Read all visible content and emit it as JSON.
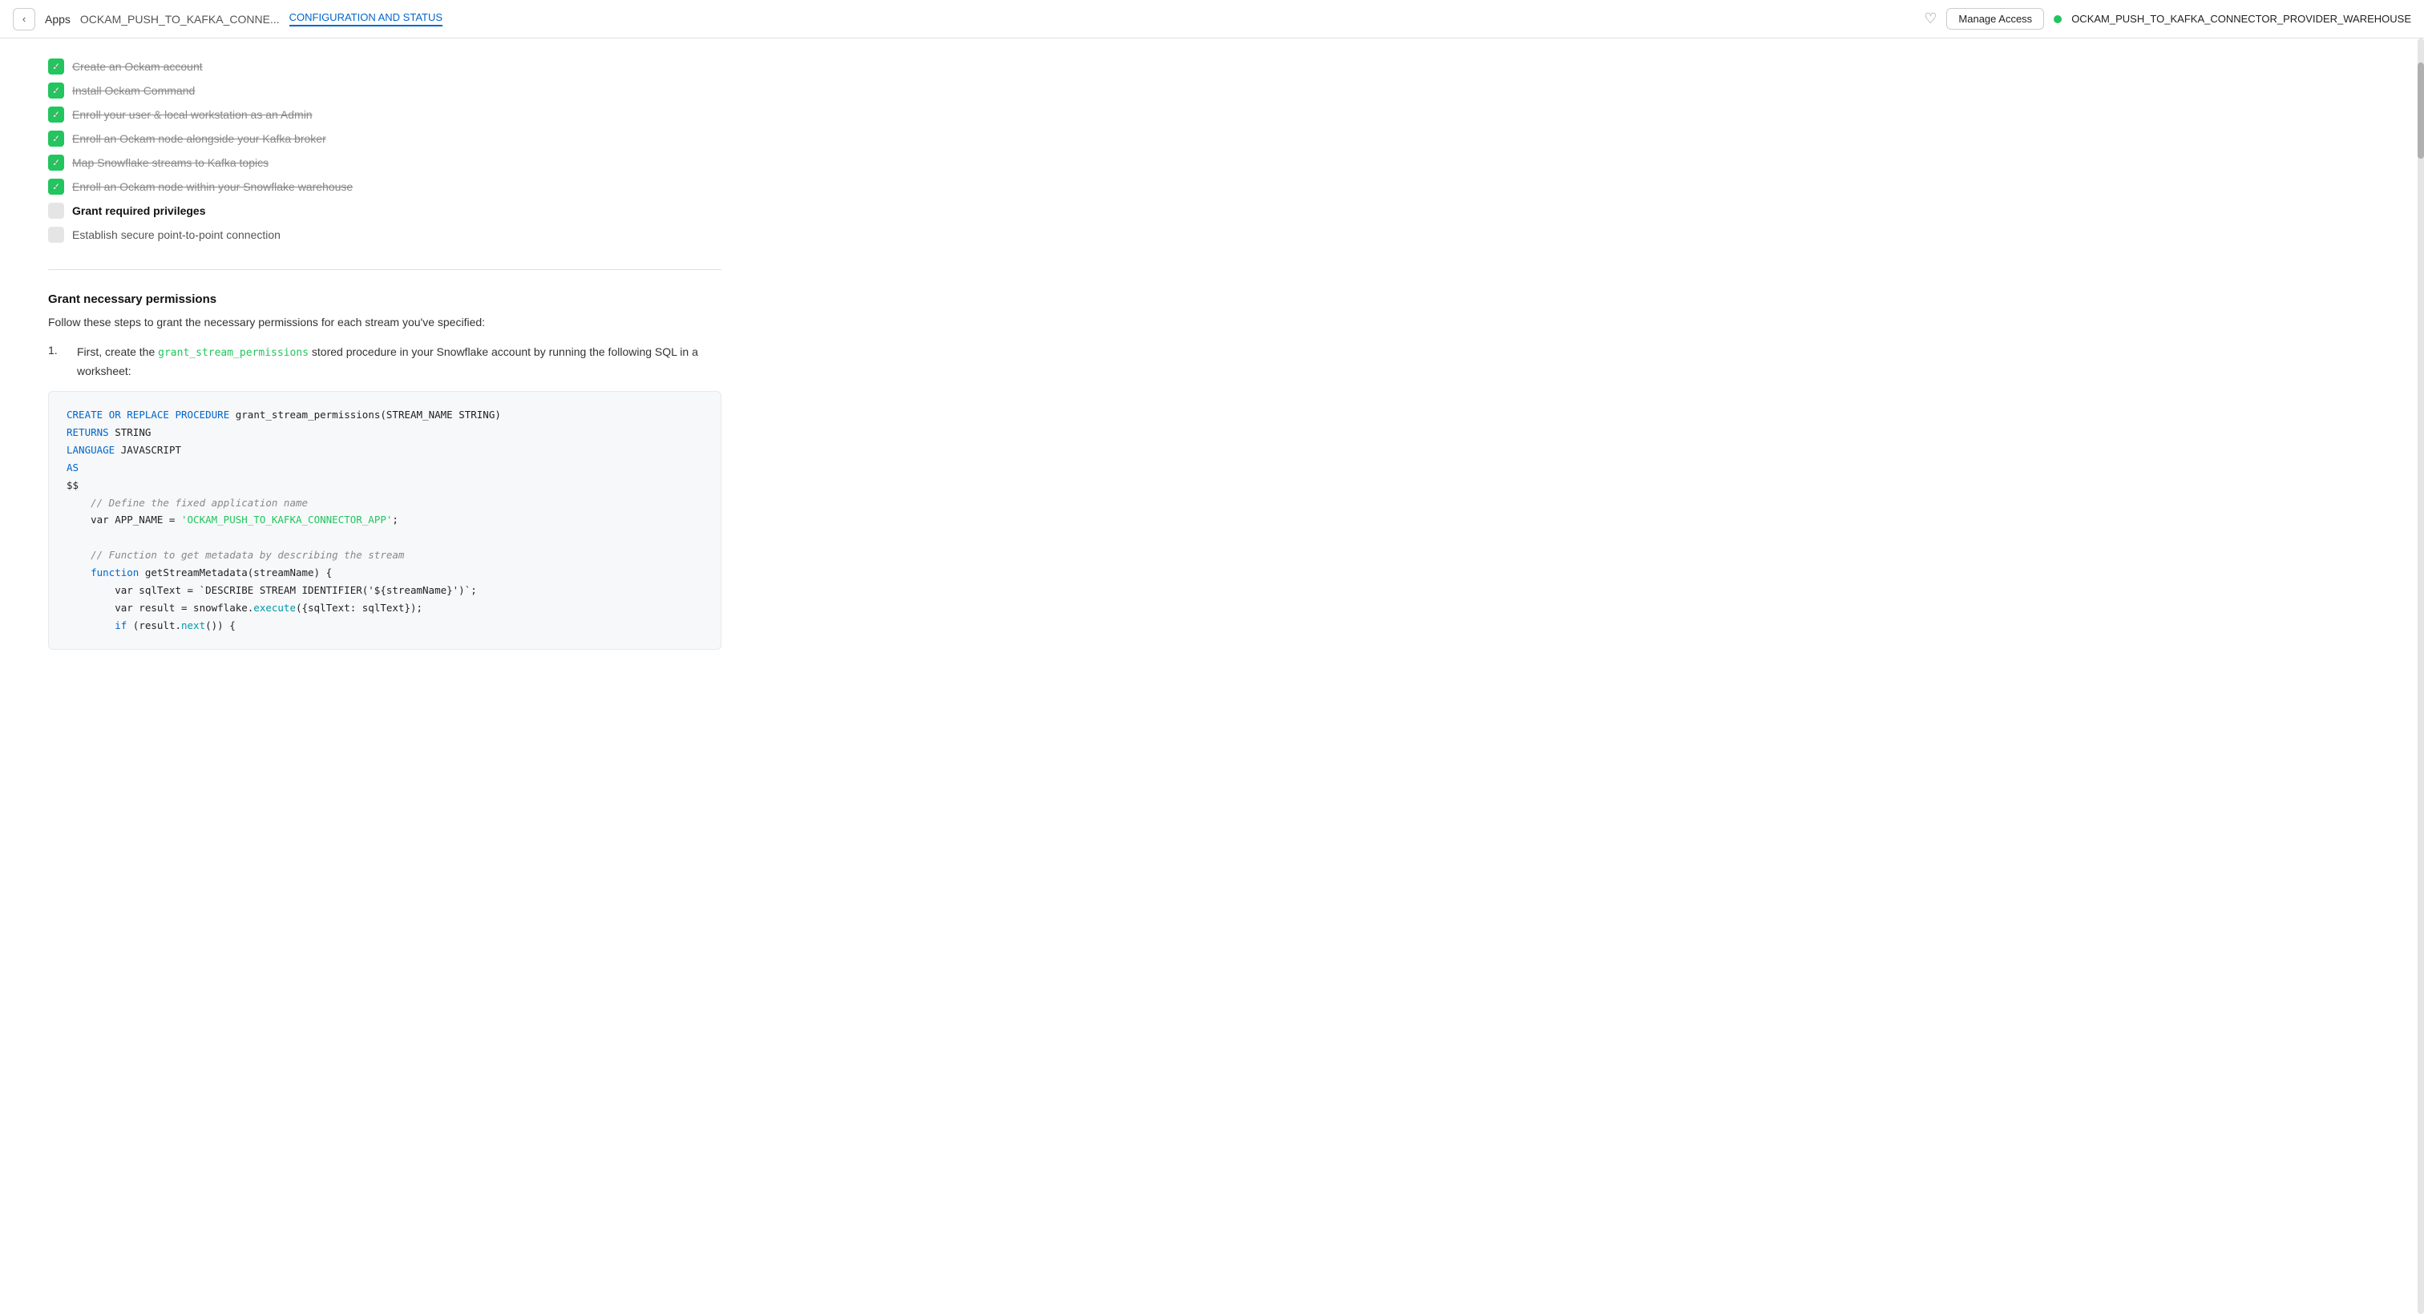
{
  "navbar": {
    "back_label": "‹",
    "apps_label": "Apps",
    "connector_name": "OCKAM_PUSH_TO_KAFKA_CONNE...",
    "tab_label": "CONFIGURATION AND STATUS",
    "manage_access_label": "Manage Access",
    "warehouse_name": "OCKAM_PUSH_TO_KAFKA_CONNECTOR_PROVIDER_WAREHOUSE"
  },
  "checklist": {
    "items": [
      {
        "id": 1,
        "label": "Create an Ockam account",
        "status": "done"
      },
      {
        "id": 2,
        "label": "Install Ockam Command",
        "status": "done"
      },
      {
        "id": 3,
        "label": "Enroll your user & local workstation as an Admin",
        "status": "done"
      },
      {
        "id": 4,
        "label": "Enroll an Ockam node alongside your Kafka broker",
        "status": "done"
      },
      {
        "id": 5,
        "label": "Map Snowflake streams to Kafka topics",
        "status": "done"
      },
      {
        "id": 6,
        "label": "Enroll an Ockam node within your Snowflake warehouse",
        "status": "done"
      },
      {
        "id": 7,
        "label": "Grant required privileges",
        "status": "active"
      },
      {
        "id": 8,
        "label": "Establish secure point-to-point connection",
        "status": "pending"
      }
    ]
  },
  "section": {
    "heading": "Grant necessary permissions",
    "description": "Follow these steps to grant the necessary permissions for each stream you've specified:",
    "step1_text_before": "First, create the ",
    "step1_code": "grant_stream_permissions",
    "step1_text_after": " stored procedure in your Snowflake account by running the following SQL in a worksheet:"
  },
  "code": {
    "line1_kw1": "CREATE",
    "line1_kw2": "OR",
    "line1_kw3": "REPLACE",
    "line1_kw4": "PROCEDURE",
    "line1_rest": " grant_stream_permissions(STREAM_NAME STRING)",
    "line2_kw": "RETURNS",
    "line2_rest": " STRING",
    "line3_kw": "LANGUAGE",
    "line3_rest": " JAVASCRIPT",
    "line4_kw": "AS",
    "line5": "$$",
    "comment1": "    // Define the fixed application name",
    "line6_var": "    var APP_NAME = ",
    "line6_str": "'OCKAM_PUSH_TO_KAFKA_CONNECTOR_APP'",
    "line6_end": ";",
    "comment2": "    // Function to get metadata by describing the stream",
    "line7_kw": "    function",
    "line7_rest": " getStreamMetadata(streamName) {",
    "line8": "        var sqlText = `DESCRIBE STREAM IDENTIFIER('${streamName}')`;",
    "line9_var": "        var result = snowflake.",
    "line9_fn": "execute",
    "line9_rest": "({sqlText: sqlText});",
    "line10_kw": "        if",
    "line10_rest": " (result.",
    "line10_fn": "next",
    "line10_end": "()) {"
  }
}
